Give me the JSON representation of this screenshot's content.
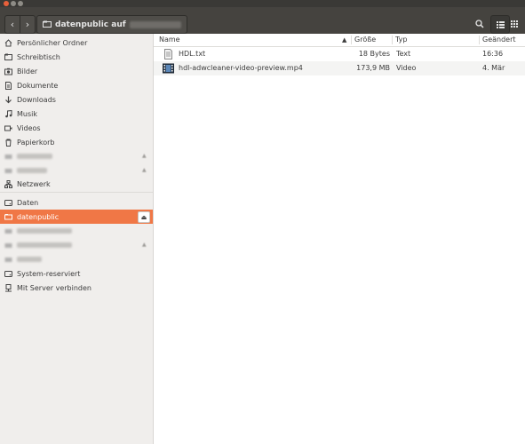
{
  "window": {
    "path_label": "datenpublic auf"
  },
  "sidebar": {
    "items": [
      {
        "label": "Persönlicher Ordner",
        "icon": "home-icon"
      },
      {
        "label": "Schreibtisch",
        "icon": "desktop-icon"
      },
      {
        "label": "Bilder",
        "icon": "camera-icon"
      },
      {
        "label": "Dokumente",
        "icon": "document-icon"
      },
      {
        "label": "Downloads",
        "icon": "download-icon"
      },
      {
        "label": "Musik",
        "icon": "music-icon"
      },
      {
        "label": "Videos",
        "icon": "video-icon"
      },
      {
        "label": "Papierkorb",
        "icon": "trash-icon"
      },
      {
        "label": "Netzwerk",
        "icon": "network-icon"
      },
      {
        "label": "Daten",
        "icon": "drive-icon"
      },
      {
        "label": "datenpublic",
        "icon": "network-folder-icon"
      },
      {
        "label": "System-reserviert",
        "icon": "drive-icon"
      },
      {
        "label": "Mit Server verbinden",
        "icon": "server-icon"
      }
    ]
  },
  "files": {
    "columns": {
      "name": "Name",
      "size": "Größe",
      "type": "Typ",
      "modified": "Geändert"
    },
    "rows": [
      {
        "name": "HDL.txt",
        "size": "18 Bytes",
        "type": "Text",
        "modified": "16:36",
        "icon": "text-file-icon"
      },
      {
        "name": "hdl-adwcleaner-video-preview.mp4",
        "size": "173,9 MB",
        "type": "Video",
        "modified": "4. Mär",
        "icon": "video-file-icon"
      }
    ]
  },
  "colors": {
    "selected": "#f07746",
    "titlebar": "#3a3936",
    "toolbar": "#45433f",
    "sidebar_bg": "#f0eeec"
  }
}
